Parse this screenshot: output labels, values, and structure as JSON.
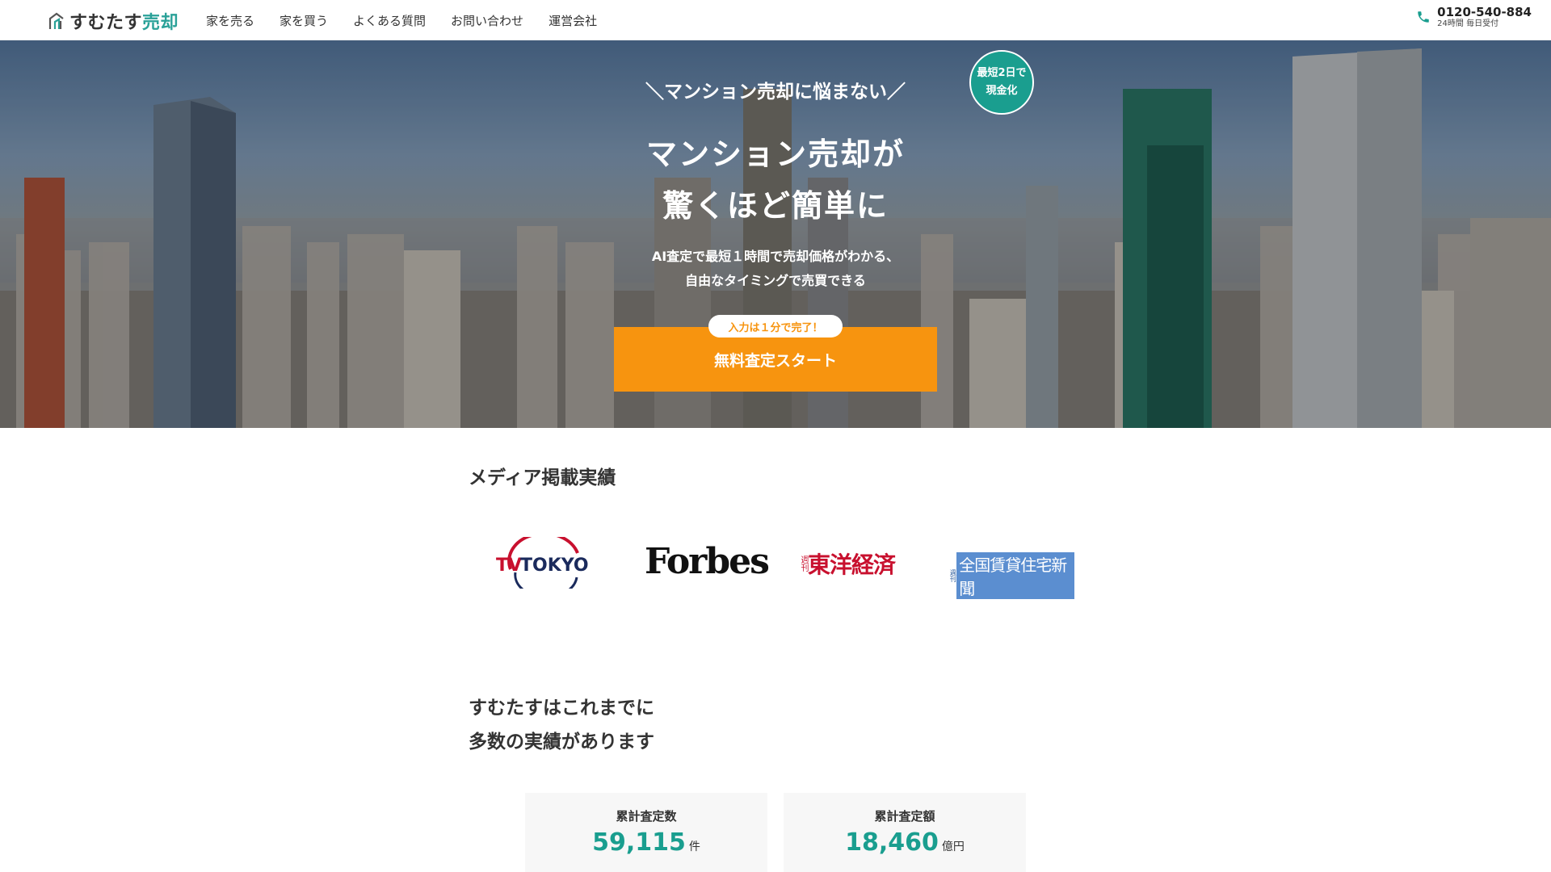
{
  "header": {
    "logo_main": "すむたす",
    "logo_accent": "売却",
    "nav": [
      "家を売る",
      "家を買う",
      "よくある質問",
      "お問い合わせ",
      "運営会社"
    ],
    "phone": "0120-540-884",
    "phone_note": "24時間 毎日受付"
  },
  "hero": {
    "tagline": "＼マンション売却に悩まない／",
    "title_line1": "マンション売却が",
    "title_line2": "驚くほど簡単に",
    "desc_line1": "AI査定で最短１時間で売却価格がわかる、",
    "desc_line2": "自由なタイミングで売買できる",
    "badge_line1": "最短2日で",
    "badge_line2": "現金化",
    "cta_pill": "入力は１分で完了！",
    "cta_label": "無料査定スタート"
  },
  "media": {
    "title": "メディア掲載実績",
    "logos": {
      "tv_tokyo_tv": "TV",
      "tv_tokyo_name": "TOKYO",
      "forbes": "Forbes",
      "toyo_small": "週刊",
      "toyo_main": "東洋経済",
      "zenkoku_small": "週刊",
      "zenkoku_main": "全国賃貸住宅新聞"
    }
  },
  "records": {
    "title_line1": "すむたすはこれまでに",
    "title_line2": "多数の実績があります",
    "stats": [
      {
        "label": "累計査定数",
        "value": "59,115",
        "unit": "件"
      },
      {
        "label": "累計査定額",
        "value": "18,460",
        "unit": "億円"
      }
    ]
  },
  "colors": {
    "accent": "#1a9e8f",
    "cta": "#f7940f",
    "toyo_red": "#c8102e",
    "zenkoku_blue": "#5b8ed0"
  }
}
